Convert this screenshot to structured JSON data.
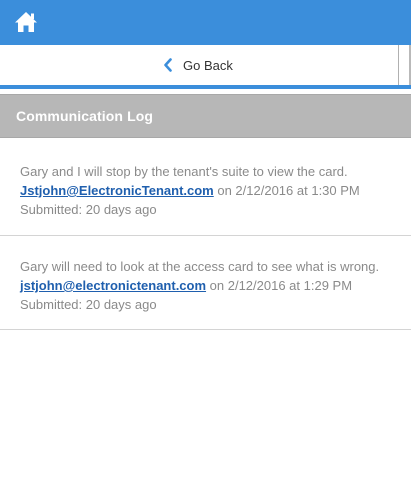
{
  "header": {
    "home_icon": "home-icon",
    "accent_color": "#3b8edb"
  },
  "nav": {
    "back_label": "Go Back",
    "back_icon": "chevron-left-icon"
  },
  "section": {
    "title": "Communication Log"
  },
  "log": {
    "entries": [
      {
        "message": "Gary and I will stop by the tenant's suite to view the card.",
        "email": "Jstjohn@ElectronicTenant.com",
        "on_text": " on 2/12/2016 at 1:30 PM",
        "submitted": "Submitted: 20 days ago"
      },
      {
        "message": "Gary will need to look at the access card to see what is wrong.",
        "email": "jstjohn@electronictenant.com",
        "on_text": " on 2/12/2016 at 1:29 PM",
        "submitted": "Submitted: 20 days ago"
      }
    ]
  }
}
